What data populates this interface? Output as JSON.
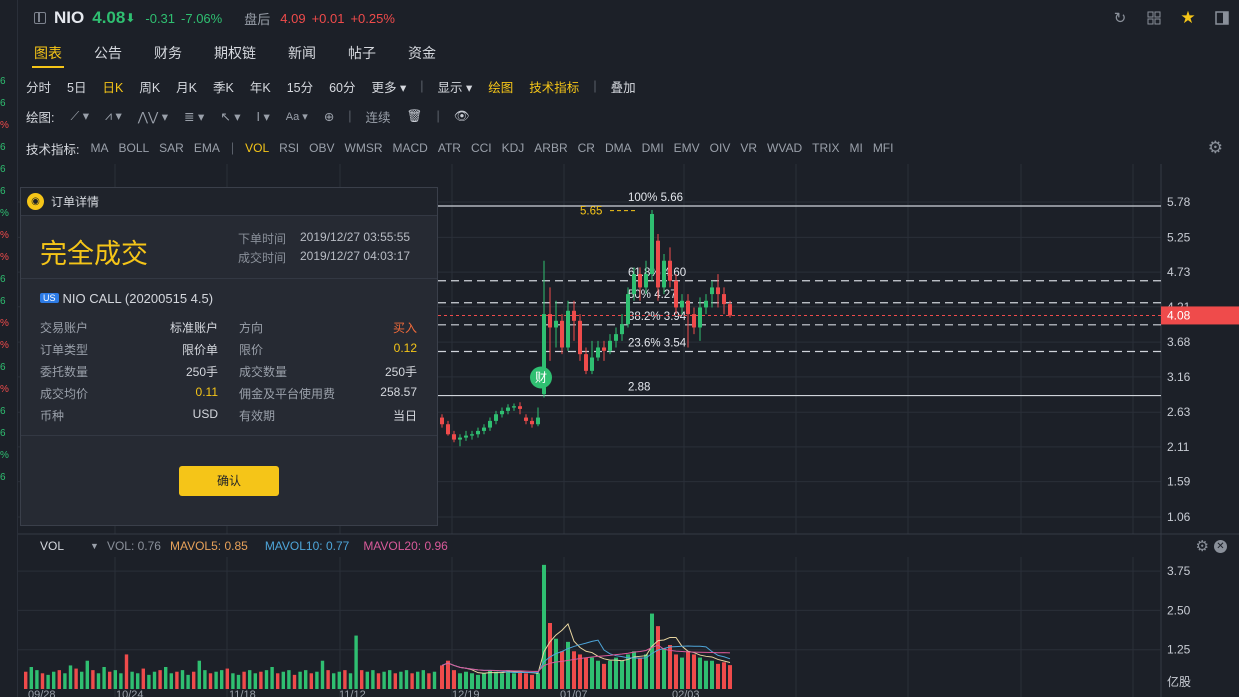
{
  "header": {
    "symbol": "NIO",
    "price": "4.08",
    "arrow": "⬇",
    "change": "-0.31",
    "change_pct": "-7.06%",
    "after_hours_label": "盘后",
    "ah_price": "4.09",
    "ah_change": "+0.01",
    "ah_change_pct": "+0.25%"
  },
  "tabs": [
    "图表",
    "公告",
    "财务",
    "期权链",
    "新闻",
    "帖子",
    "资金"
  ],
  "periods": [
    "分时",
    "5日",
    "日K",
    "周K",
    "月K",
    "季K",
    "年K",
    "15分",
    "60分"
  ],
  "toolbar_r1": {
    "more": "更多",
    "display": "显示",
    "draw": "绘图",
    "indicators": "技术指标",
    "overlay": "叠加"
  },
  "toolbar_r2": {
    "draw_label": "绘图:",
    "continuous": "连续"
  },
  "indicators_label": "技术指标:",
  "indicators": [
    "MA",
    "BOLL",
    "SAR",
    "EMA",
    "VOL",
    "RSI",
    "OBV",
    "WMSR",
    "MACD",
    "ATR",
    "CCI",
    "KDJ",
    "ARBR",
    "CR",
    "DMA",
    "DMI",
    "EMV",
    "OIV",
    "VR",
    "WVAD",
    "TRIX",
    "MI",
    "MFI"
  ],
  "price_axis": [
    "5.78",
    "5.25",
    "4.73",
    "4.21",
    "3.68",
    "3.16",
    "2.63",
    "2.11",
    "1.59",
    "1.06"
  ],
  "current_price_tag": "4.08",
  "fib": {
    "p100": "100% 5.66",
    "p618": "61.8% 4.60",
    "p50": "50% 4.27",
    "p382": "38.2% 3.94",
    "p236": "23.6% 3.54",
    "low": "2.88",
    "high_mark": "5.65"
  },
  "event_badge": "财",
  "vol": {
    "title": "VOL",
    "vol": "VOL: 0.76",
    "ma5": "MAVOL5: 0.85",
    "ma10": "MAVOL10: 0.77",
    "ma20": "MAVOL20: 0.96",
    "axis": [
      "3.75",
      "2.50",
      "1.25"
    ],
    "unit": "亿股"
  },
  "x_dates": [
    "09/28",
    "10/24",
    "11/18",
    "11/12",
    "12/19",
    "01/07",
    "02/03"
  ],
  "colors": {
    "up": "#2fbf71",
    "down": "#ef4b4b",
    "accent": "#f5c518"
  },
  "order": {
    "title": "订单详情",
    "status": "完全成交",
    "order_time_label": "下单时间",
    "order_time": "2019/12/27 03:55:55",
    "fill_time_label": "成交时间",
    "fill_time": "2019/12/27 04:03:17",
    "market": "US",
    "contract": "NIO CALL (20200515 4.5)",
    "rows": [
      {
        "l1": "交易账户",
        "v1": "标准账户",
        "l2": "方向",
        "v2": "买入"
      },
      {
        "l1": "订单类型",
        "v1": "限价单",
        "l2": "限价",
        "v2": "0.12"
      },
      {
        "l1": "委托数量",
        "v1": "250手",
        "l2": "成交数量",
        "v2": "250手"
      },
      {
        "l1": "成交均价",
        "v1": "0.11",
        "l2": "佣金及平台使用费",
        "v2": "258.57"
      },
      {
        "l1": "币种",
        "v1": "USD",
        "l2": "有效期",
        "v2": "当日"
      }
    ],
    "confirm": "确认"
  },
  "left_strip": [
    {
      "c": "green",
      "t": "6"
    },
    {
      "c": "green",
      "t": "6"
    },
    {
      "c": "red",
      "t": "%"
    },
    {
      "c": "green",
      "t": "6"
    },
    {
      "c": "green",
      "t": "6"
    },
    {
      "c": "green",
      "t": "6"
    },
    {
      "c": "green",
      "t": "%"
    },
    {
      "c": "red",
      "t": "%"
    },
    {
      "c": "red",
      "t": "%"
    },
    {
      "c": "green",
      "t": "6"
    },
    {
      "c": "green",
      "t": "6"
    },
    {
      "c": "red",
      "t": "%"
    },
    {
      "c": "red",
      "t": "%"
    },
    {
      "c": "green",
      "t": "6"
    },
    {
      "c": "red",
      "t": "%"
    },
    {
      "c": "green",
      "t": "6"
    },
    {
      "c": "green",
      "t": "6"
    },
    {
      "c": "green",
      "t": "%"
    },
    {
      "c": "green",
      "t": "6"
    }
  ],
  "chart_data": {
    "type": "candlestick",
    "candles": [
      [
        2.55,
        2.45,
        2.6,
        2.4
      ],
      [
        2.45,
        2.3,
        2.5,
        2.28
      ],
      [
        2.3,
        2.22,
        2.35,
        2.18
      ],
      [
        2.22,
        2.25,
        2.3,
        2.12
      ],
      [
        2.25,
        2.28,
        2.35,
        2.2
      ],
      [
        2.28,
        2.3,
        2.35,
        2.22
      ],
      [
        2.3,
        2.35,
        2.4,
        2.25
      ],
      [
        2.35,
        2.4,
        2.45,
        2.3
      ],
      [
        2.4,
        2.5,
        2.55,
        2.35
      ],
      [
        2.5,
        2.6,
        2.65,
        2.45
      ],
      [
        2.6,
        2.65,
        2.7,
        2.55
      ],
      [
        2.65,
        2.7,
        2.75,
        2.6
      ],
      [
        2.7,
        2.72,
        2.76,
        2.65
      ],
      [
        2.72,
        2.68,
        2.78,
        2.6
      ],
      [
        2.55,
        2.5,
        2.6,
        2.45
      ],
      [
        2.5,
        2.45,
        2.55,
        2.4
      ],
      [
        2.45,
        2.55,
        2.7,
        2.42
      ],
      [
        2.9,
        4.1,
        4.9,
        2.85
      ],
      [
        4.1,
        3.9,
        4.5,
        3.4
      ],
      [
        3.9,
        4.0,
        4.3,
        3.6
      ],
      [
        4.0,
        3.6,
        4.1,
        3.5
      ],
      [
        3.6,
        4.15,
        4.3,
        3.55
      ],
      [
        4.15,
        4.0,
        4.3,
        3.7
      ],
      [
        4.0,
        3.5,
        4.1,
        3.4
      ],
      [
        3.5,
        3.25,
        3.6,
        3.2
      ],
      [
        3.25,
        3.45,
        3.7,
        3.2
      ],
      [
        3.45,
        3.6,
        3.7,
        3.4
      ],
      [
        3.6,
        3.55,
        3.7,
        3.4
      ],
      [
        3.55,
        3.7,
        3.8,
        3.5
      ],
      [
        3.7,
        3.8,
        3.9,
        3.6
      ],
      [
        3.8,
        3.95,
        4.1,
        3.7
      ],
      [
        3.95,
        4.4,
        4.5,
        3.9
      ],
      [
        4.4,
        4.7,
        4.8,
        4.3
      ],
      [
        4.7,
        4.5,
        4.8,
        4.3
      ],
      [
        4.5,
        4.7,
        4.9,
        4.4
      ],
      [
        4.7,
        5.6,
        5.66,
        4.6
      ],
      [
        5.2,
        4.5,
        5.3,
        4.3
      ],
      [
        4.5,
        4.9,
        5.0,
        4.4
      ],
      [
        4.9,
        4.6,
        5.1,
        4.5
      ],
      [
        4.6,
        4.2,
        4.7,
        4.1
      ],
      [
        4.2,
        4.3,
        4.4,
        4.1
      ],
      [
        4.3,
        4.1,
        4.4,
        3.6
      ],
      [
        4.1,
        3.9,
        4.2,
        3.8
      ],
      [
        3.9,
        4.2,
        4.35,
        3.7
      ],
      [
        4.2,
        4.3,
        4.4,
        4.1
      ],
      [
        4.4,
        4.5,
        4.6,
        4.2
      ],
      [
        4.5,
        4.4,
        4.7,
        4.2
      ],
      [
        4.4,
        4.25,
        4.5,
        4.1
      ],
      [
        4.25,
        4.08,
        4.3,
        4.05
      ]
    ],
    "volume": [
      0.75,
      0.9,
      0.6,
      0.5,
      0.55,
      0.5,
      0.45,
      0.5,
      0.6,
      0.55,
      0.5,
      0.6,
      0.5,
      0.55,
      0.5,
      0.45,
      0.5,
      3.95,
      2.1,
      1.6,
      1.2,
      1.5,
      1.2,
      1.1,
      1.0,
      1.0,
      0.9,
      0.8,
      0.9,
      1.0,
      0.9,
      1.1,
      1.2,
      1.0,
      1.1,
      2.4,
      2.0,
      1.3,
      1.4,
      1.1,
      1.0,
      1.2,
      1.1,
      1.0,
      0.9,
      0.9,
      0.8,
      0.85,
      0.76
    ]
  }
}
